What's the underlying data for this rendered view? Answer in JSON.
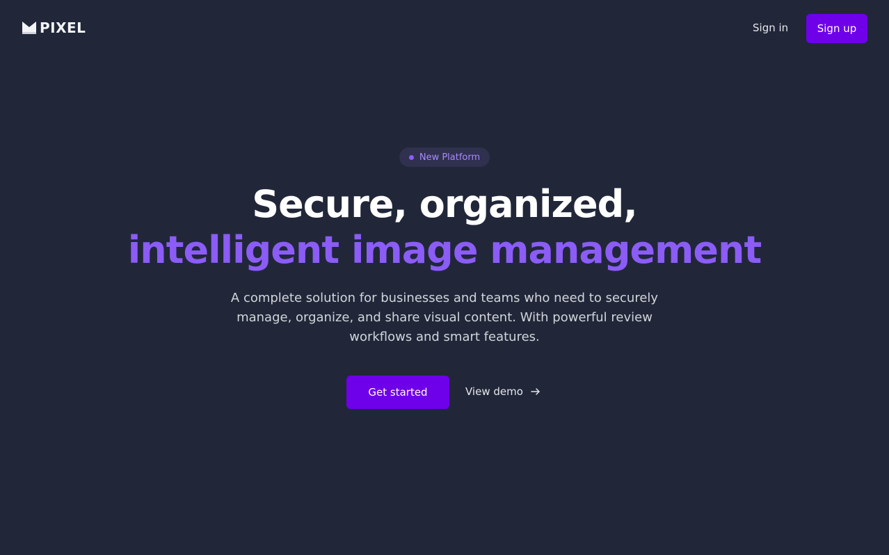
{
  "brand": {
    "logo_icon": "pixel-logo-mark",
    "name": "PIXEL"
  },
  "nav": {
    "signin_label": "Sign in",
    "signup_label": "Sign up"
  },
  "hero": {
    "badge_text": "New Platform",
    "headline_line1": "Secure, organized,",
    "headline_line2": "intelligent image management",
    "description": "A complete solution for businesses and teams who need to securely manage, organize, and share visual content. With powerful review workflows and smart features.",
    "primary_cta": "Get started",
    "secondary_cta": "View demo",
    "secondary_cta_icon": "arrow-right-icon"
  },
  "colors": {
    "background": "#212739",
    "accent": "#6f00ea",
    "highlight_text": "#8b5cf6",
    "badge_background": "#30304f",
    "badge_text": "#a78bfa"
  }
}
